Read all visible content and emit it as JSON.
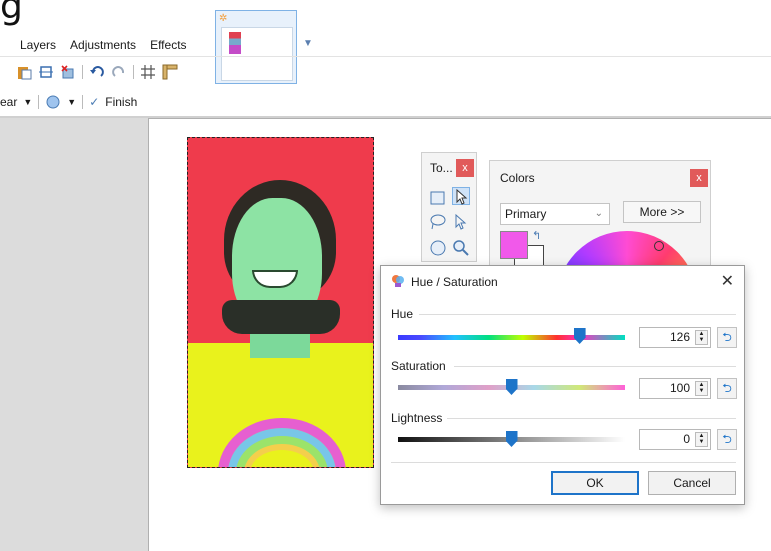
{
  "title_fragment": "g",
  "menu": {
    "items": [
      "Layers",
      "Adjustments",
      "Effects"
    ]
  },
  "toolbar2": {
    "blend_label": "ear",
    "finish_label": "Finish"
  },
  "tools_window": {
    "title": "To...",
    "close": "x"
  },
  "colors_window": {
    "title": "Colors",
    "close": "x",
    "select_value": "Primary",
    "more_button": "More >>",
    "primary_color": "#f159ea"
  },
  "dialog": {
    "title": "Hue / Saturation",
    "close": "✕",
    "hue": {
      "label": "Hue",
      "value": "126",
      "level": 0.8
    },
    "saturation": {
      "label": "Saturation",
      "value": "100",
      "level": 0.5
    },
    "lightness": {
      "label": "Lightness",
      "value": "0",
      "level": 0.5
    },
    "ok": "OK",
    "cancel": "Cancel"
  },
  "colors": {
    "accent": "#1e74c9",
    "photo_bg": "#ef3b4c",
    "shirt": "#e9f21c"
  }
}
